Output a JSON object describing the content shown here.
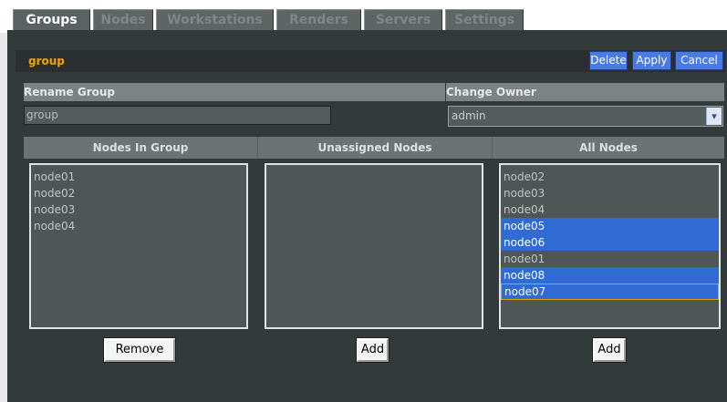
{
  "tabs": [
    {
      "label": "Groups",
      "active": true
    },
    {
      "label": "Nodes",
      "active": false
    },
    {
      "label": "Workstations",
      "active": false
    },
    {
      "label": "Renders",
      "active": false
    },
    {
      "label": "Servers",
      "active": false
    },
    {
      "label": "Settings",
      "active": false
    }
  ],
  "header": {
    "group_name": "group",
    "delete_label": "Delete",
    "apply_label": "Apply",
    "cancel_label": "Cancel"
  },
  "rename": {
    "label": "Rename Group",
    "value": "group"
  },
  "owner": {
    "label": "Change Owner",
    "value": "admin",
    "arrow_icon": "chevron-down-icon"
  },
  "columns": {
    "nodes_in_group": "Nodes In Group",
    "unassigned": "Unassigned Nodes",
    "all_nodes": "All Nodes"
  },
  "lists": {
    "nodes_in_group": [
      {
        "label": "node01"
      },
      {
        "label": "node02"
      },
      {
        "label": "node03"
      },
      {
        "label": "node04"
      }
    ],
    "unassigned": [],
    "all_nodes": [
      {
        "label": "node02",
        "selected": false
      },
      {
        "label": "node03",
        "selected": false
      },
      {
        "label": "node04",
        "selected": false
      },
      {
        "label": "node05",
        "selected": true
      },
      {
        "label": "node06",
        "selected": true
      },
      {
        "label": "node01",
        "selected": false
      },
      {
        "label": "node08",
        "selected": true
      },
      {
        "label": "node07",
        "selected": true
      }
    ]
  },
  "buttons": {
    "remove_label": "Remove",
    "add_unassigned_label": "Add",
    "add_all_label": "Add"
  },
  "colors": {
    "accent": "#f0a400",
    "selection": "#2f6bd2"
  }
}
